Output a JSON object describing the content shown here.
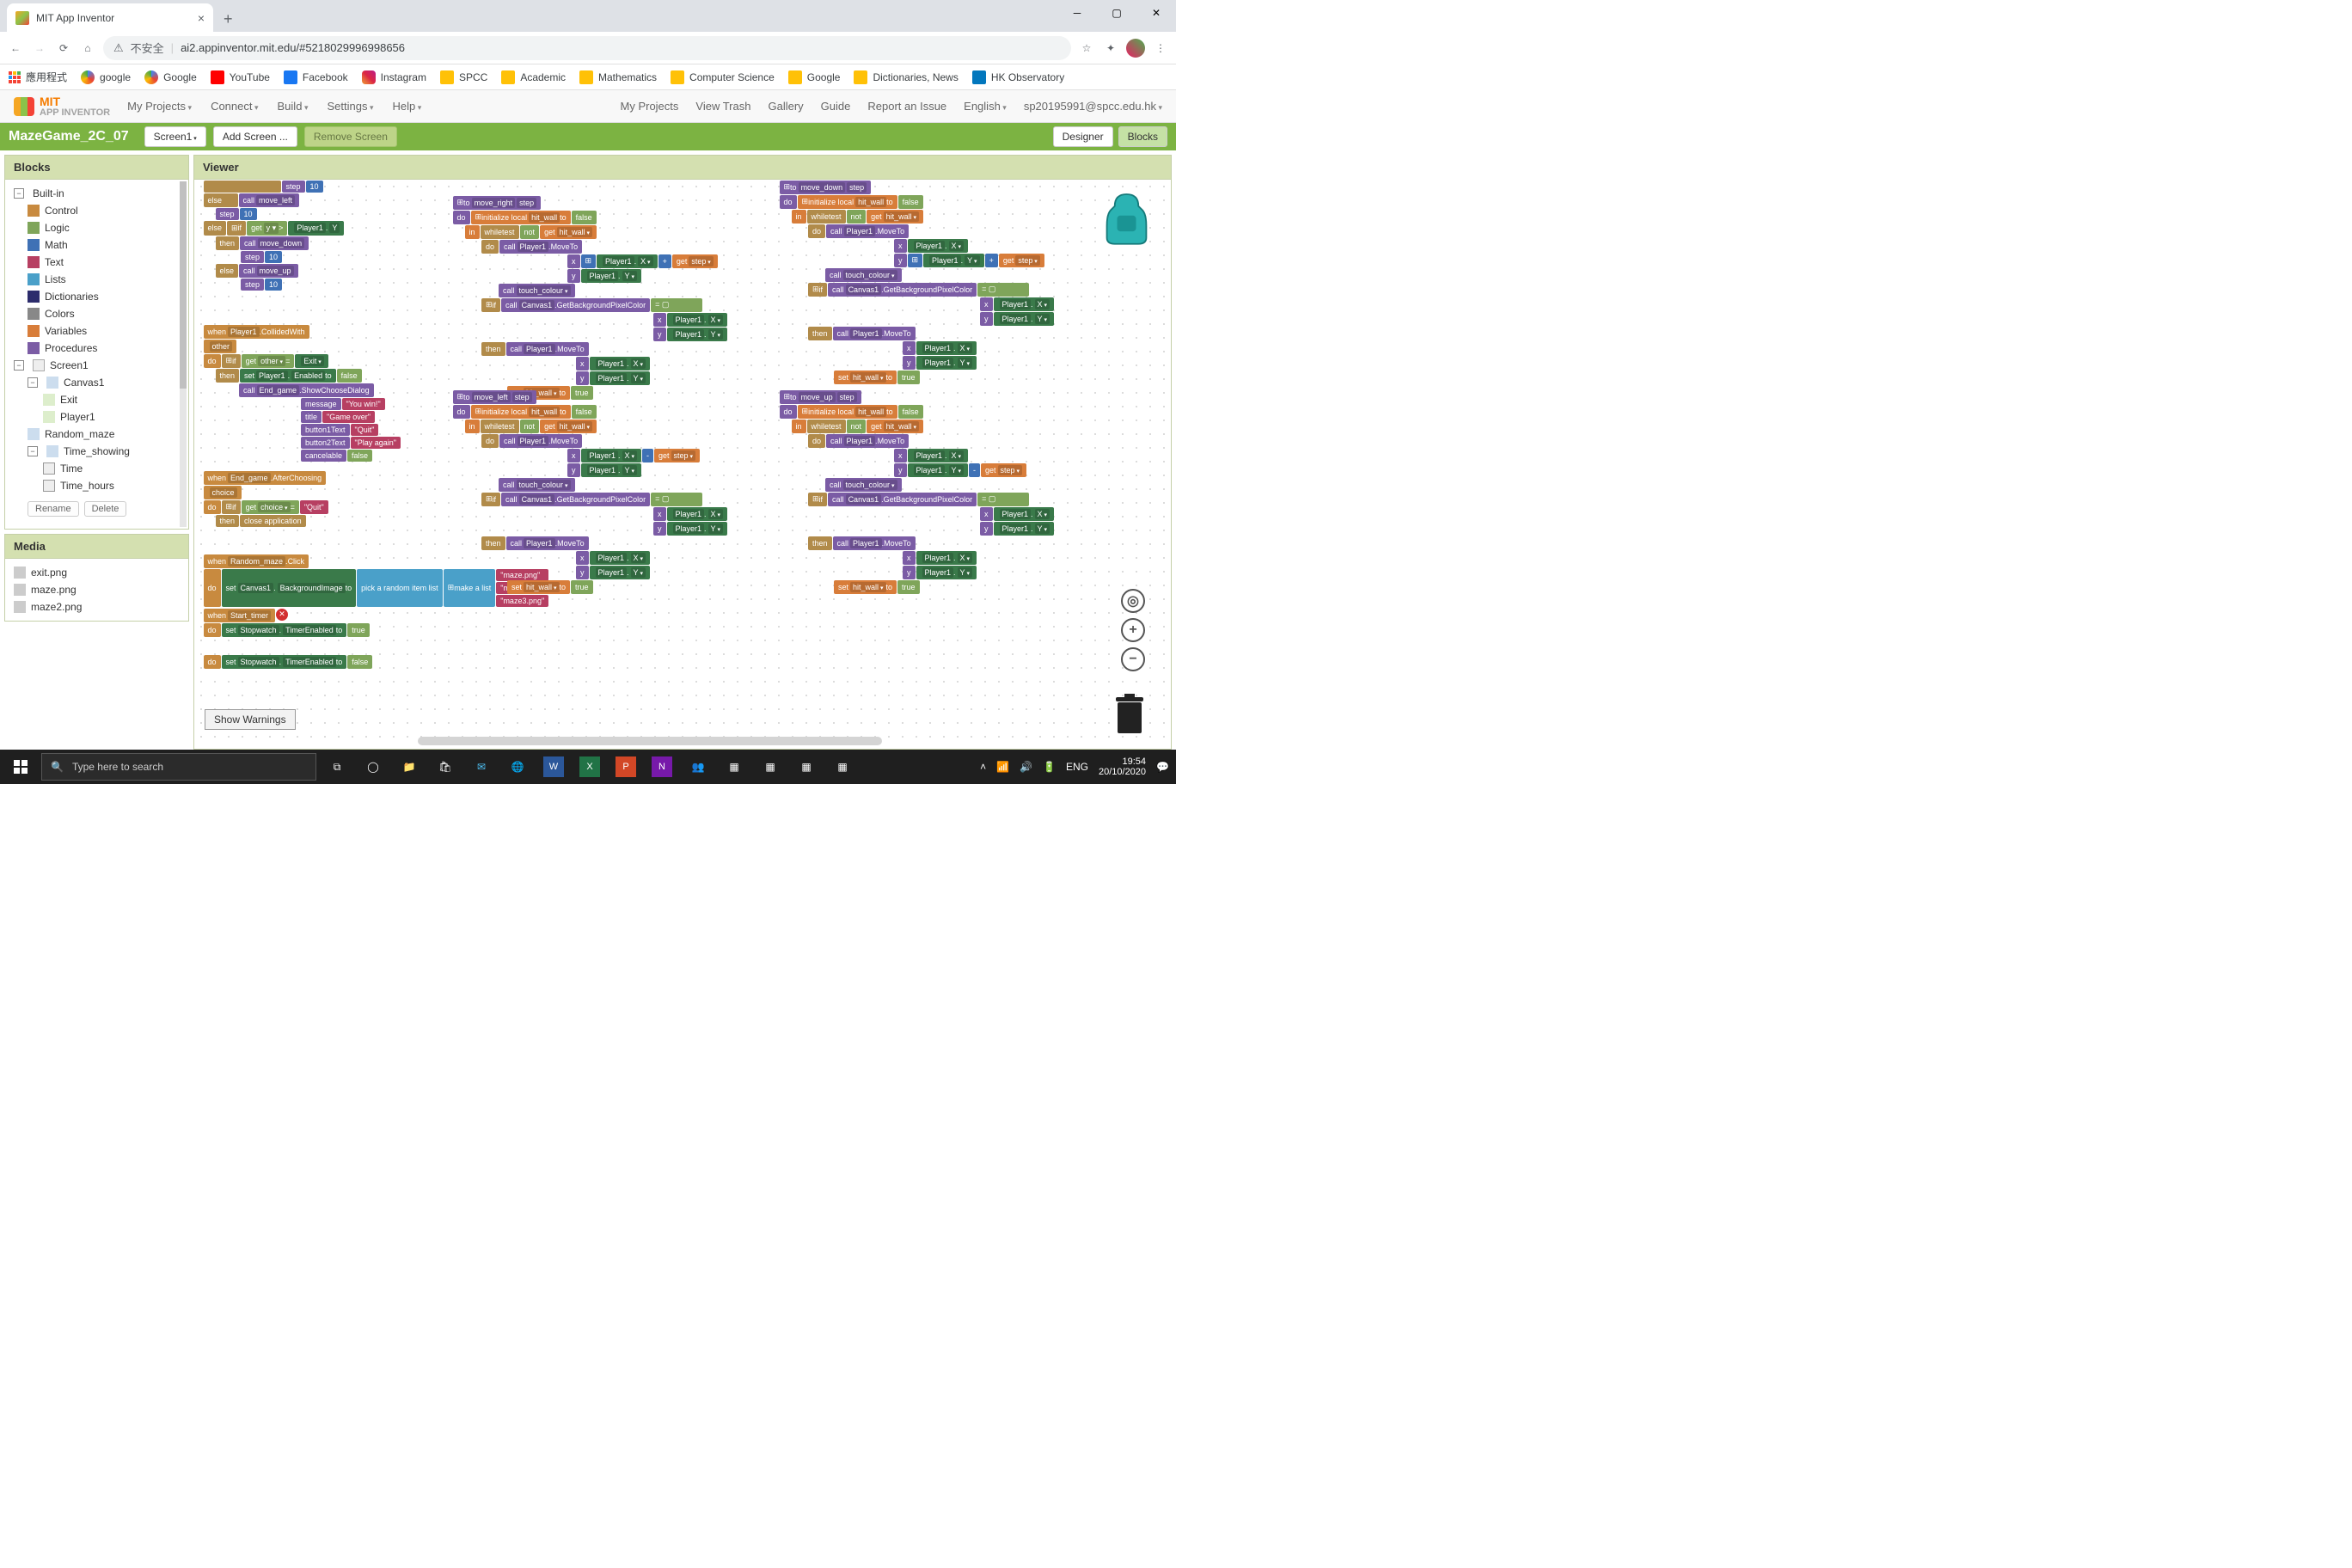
{
  "browser": {
    "tab_title": "MIT App Inventor",
    "url_prefix": "不安全",
    "url": "ai2.appinventor.mit.edu/#5218029996998656",
    "bookmarks": [
      "應用程式",
      "google",
      "Google",
      "YouTube",
      "Facebook",
      "Instagram",
      "SPCC",
      "Academic",
      "Mathematics",
      "Computer Science",
      "Google",
      "Dictionaries, News",
      "HK Observatory"
    ]
  },
  "header": {
    "logo_top": "MIT",
    "logo_bottom": "APP INVENTOR",
    "menu_left": [
      "My Projects",
      "Connect",
      "Build",
      "Settings",
      "Help"
    ],
    "menu_right": [
      "My Projects",
      "View Trash",
      "Gallery",
      "Guide",
      "Report an Issue",
      "English",
      "sp20195991@spcc.edu.hk"
    ]
  },
  "project": {
    "name": "MazeGame_2C_07",
    "screen_btn": "Screen1",
    "add_screen": "Add Screen ...",
    "remove_screen": "Remove Screen",
    "designer": "Designer",
    "blocks": "Blocks"
  },
  "blocks_panel": {
    "title": "Blocks",
    "builtin": "Built-in",
    "cats": [
      {
        "label": "Control",
        "color": "#c88a3f"
      },
      {
        "label": "Logic",
        "color": "#7fa55a"
      },
      {
        "label": "Math",
        "color": "#3f71b5"
      },
      {
        "label": "Text",
        "color": "#b73f62"
      },
      {
        "label": "Lists",
        "color": "#4aa0c9"
      },
      {
        "label": "Dictionaries",
        "color": "#2c2c6c"
      },
      {
        "label": "Colors",
        "color": "#888888"
      },
      {
        "label": "Variables",
        "color": "#d87d3a"
      },
      {
        "label": "Procedures",
        "color": "#7b5ca5"
      }
    ],
    "screen": "Screen1",
    "components": [
      "Canvas1",
      "Exit",
      "Player1",
      "Random_maze",
      "Time_showing",
      "Time",
      "Time_hours"
    ],
    "rename": "Rename",
    "delete": "Delete"
  },
  "media": {
    "title": "Media",
    "files": [
      "exit.png",
      "maze.png",
      "maze2.png"
    ]
  },
  "viewer": {
    "title": "Viewer",
    "show_warnings": "Show Warnings",
    "blocks_text": {
      "step": "step",
      "else": "else",
      "elseif": "else if",
      "then": "then",
      "call": "call",
      "if": "if",
      "when": "when",
      "do": "do",
      "in": "in",
      "to": "to",
      "get": "get",
      "set": "set",
      "not": "not",
      "test": "test",
      "while": "while",
      "initialize_local": "initialize local",
      "hit_wall": "hit_wall",
      "false": "false",
      "true": "true",
      "ten": "10",
      "move_left": "move_left",
      "move_right": "move_right",
      "move_down": "move_down",
      "move_up": "move_up",
      "player1": "Player1",
      "canvas1": "Canvas1",
      "moveto": "MoveTo",
      "x": "x",
      "y": "y",
      "X": "X",
      "Y": "Y",
      "touch_colour": "touch_colour",
      "getbgpx": "GetBackgroundPixelColor",
      "collidedwith": "CollidedWith",
      "other": "other",
      "exit": "Exit",
      "enabled": "Enabled",
      "end_game": "End_game",
      "showchoose": "ShowChooseDialog",
      "message": "message",
      "title": "title",
      "b1t": "button1Text",
      "b2t": "button2Text",
      "cancelable": "cancelable",
      "youwin": "You win!",
      "gameover": "Game over",
      "quit": "Quit",
      "playagain": "Play again",
      "afterchoosing": "AfterChoosing",
      "choice": "choice",
      "closeapp": "close application",
      "random_maze": "Random_maze",
      "click": "Click",
      "bgimage": "BackgroundImage",
      "pickrandom": "pick a random item  list",
      "makealist": "make a list",
      "maze1": "maze.png",
      "maze2": "maze2.png",
      "maze3": "maze3.png",
      "start_timer": "Start_timer",
      "stopwatch": "Stopwatch",
      "timerenabled": "TimerEnabled"
    }
  },
  "taskbar": {
    "search_placeholder": "Type here to search",
    "lang": "ENG",
    "time": "19:54",
    "date": "20/10/2020"
  }
}
